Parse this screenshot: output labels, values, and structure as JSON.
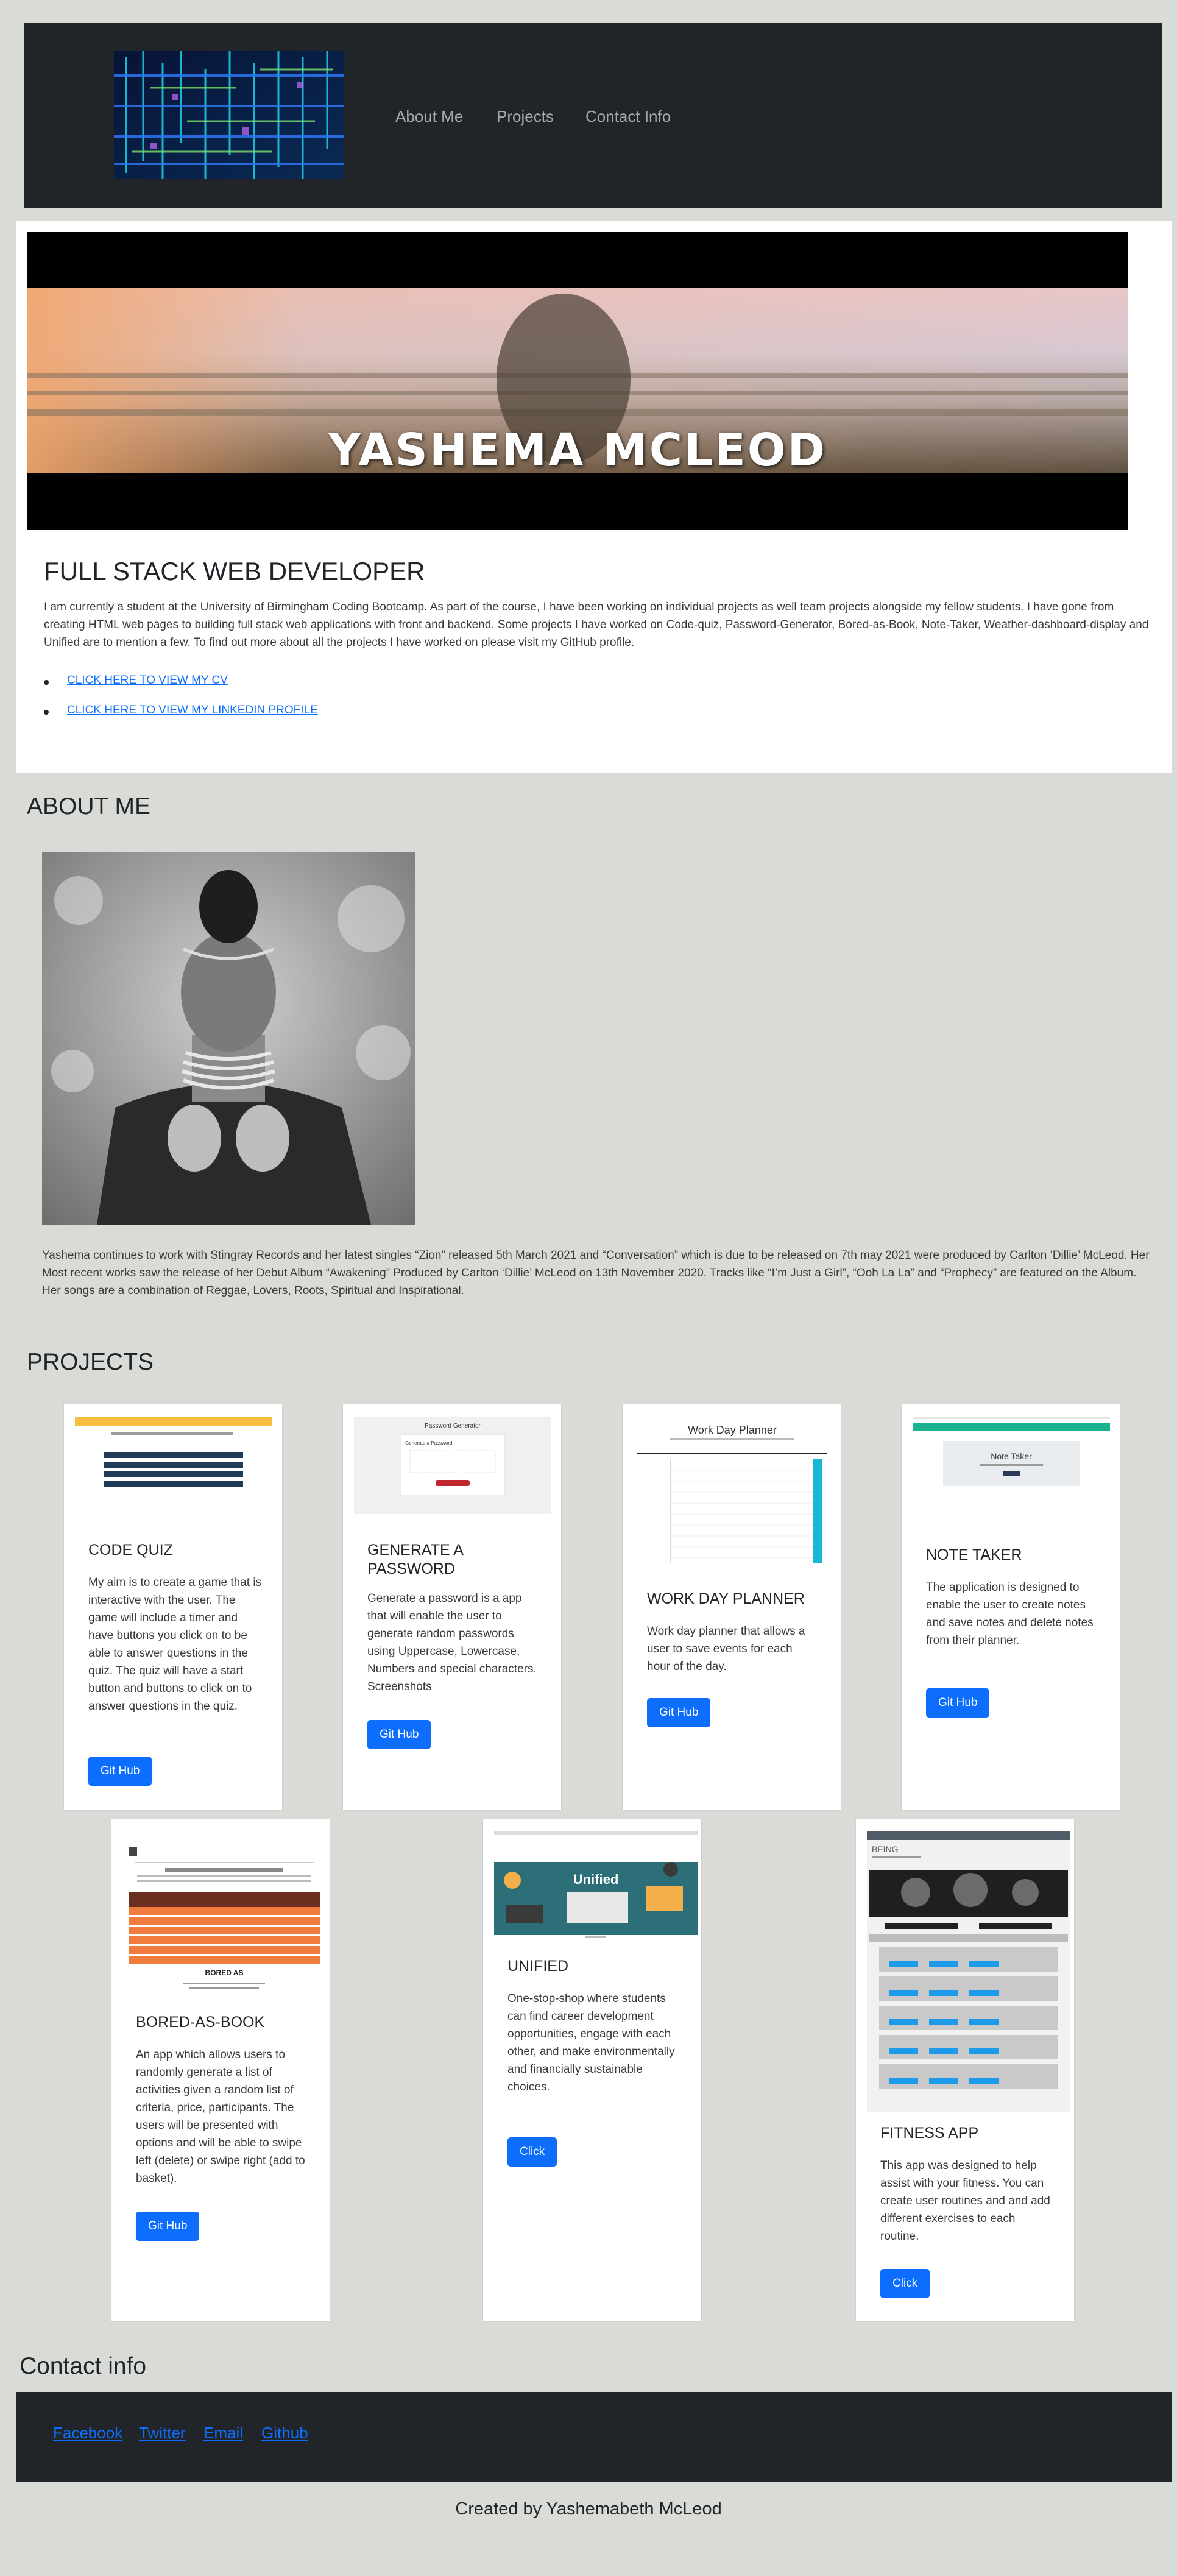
{
  "nav": {
    "links": [
      "About Me",
      "Projects",
      "Contact Info"
    ]
  },
  "hero": {
    "banner_name": "YASHEMA MCLEOD",
    "title": "FULL STACK WEB DEVELOPER",
    "intro": "I am currently a student at the University of Birmingham Coding Bootcamp. As part of the course, I have been working on individual projects as well team projects alongside my fellow students. I have gone from creating HTML web pages to building full stack web applications with front and backend. Some projects I have worked on Code-quiz, Password-Generator, Bored-as-Book, Note-Taker, Weather-dashboard-display and Unified are to mention a few. To find out more about all the projects I have worked on please visit my GitHub profile.",
    "links": [
      "CLICK HERE TO VIEW MY CV",
      "CLICK HERE TO VIEW MY LINKEDIN PROFILE"
    ]
  },
  "about": {
    "title": "ABOUT ME",
    "text": "Yashema continues to work with Stingray Records and her latest singles “Zion” released 5th March 2021 and “Conversation” which is due to be released on 7th may 2021 were produced by Carlton ‘Dillie’ McLeod. Her Most recent works saw the release of her Debut Album “Awakening” Produced by Carlton ‘Dillie’ McLeod on 13th November 2020. Tracks like “I’m Just a Girl”, “Ooh La La” and “Prophecy” are featured on the Album. Her songs are a combination of Reggae, Lovers, Roots, Spiritual and Inspirational."
  },
  "projects": {
    "title": "PROJECTS",
    "items": [
      {
        "title": "CODE QUIZ",
        "text": "My aim is to create a game that is interactive with the user. The game will include a timer and have buttons you click on to be able to answer questions in the quiz. The quiz will have a start button and buttons to click on to answer questions in the quiz.",
        "button": "Git Hub"
      },
      {
        "title": "GENERATE A PASSWORD",
        "text": "Generate a password is a app that will enable the user to generate random passwords using Uppercase, Lowercase, Numbers and special characters. Screenshots",
        "button": "Git Hub"
      },
      {
        "title": "WORK DAY PLANNER",
        "text": "Work day planner that allows a user to save events for each hour of the day.",
        "button": "Git Hub"
      },
      {
        "title": "NOTE TAKER",
        "text": "The application is designed to enable the user to create notes and save notes and delete notes from their planner.",
        "button": "Git Hub"
      },
      {
        "title": "BORED-AS-BOOK",
        "text": "An app which allows users to randomly generate a list of activities given a random list of criteria, price, participants. The users will be presented with options and will be able to swipe left (delete) or swipe right (add to basket).",
        "button": "Git Hub"
      },
      {
        "title": "UNIFIED",
        "text": "One-stop-shop where students can find career development opportunities, engage with each other, and make environmentally and financially sustainable choices.",
        "button": "Click"
      },
      {
        "title": "FITNESS APP",
        "text": "This app was designed to help assist with your fitness. You can create user routines and and add different exercises to each routine.",
        "button": "Click"
      }
    ],
    "thumbs": {
      "planner_title": "Work Day Planner",
      "note_title": "Note Taker",
      "password_title": "Password Generator",
      "password_sub": "Generate a Password",
      "bored_title": "BORED AS",
      "unified_title": "Unified",
      "being_title": "BEING"
    }
  },
  "contact": {
    "title": "Contact info",
    "links": [
      "Facebook",
      "Twitter",
      "Email",
      "Github"
    ]
  },
  "footer": {
    "text": "Created by Yashemabeth McLeod"
  },
  "colors": {
    "page_bg": "#d9dbd6",
    "nav_bg": "#212529",
    "accent": "#0d6efd"
  }
}
